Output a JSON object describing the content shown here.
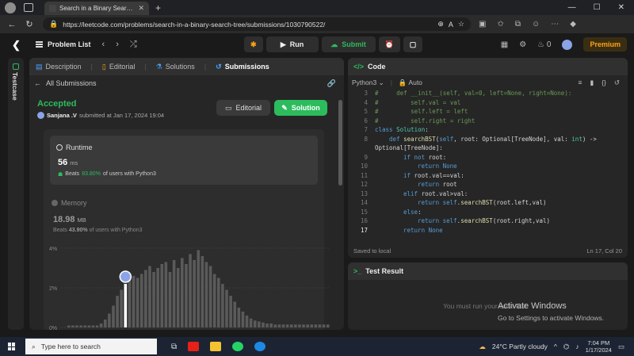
{
  "browser": {
    "tab_title": "Search in a Binary Search Tree - L",
    "url": "https://leetcode.com/problems/search-in-a-binary-search-tree/submissions/1030790522/"
  },
  "header": {
    "problem_list": "Problem List",
    "run": "Run",
    "submit": "Submit",
    "streak_count": "0",
    "premium": "Premium"
  },
  "rail": {
    "label": "Testcase"
  },
  "left_tabs": [
    {
      "label": "Description"
    },
    {
      "label": "Editorial"
    },
    {
      "label": "Solutions"
    },
    {
      "label": "Submissions"
    }
  ],
  "submission": {
    "back_label": "All Submissions",
    "status": "Accepted",
    "user": "Sanjana .V",
    "submitted_text": "submitted at Jan 17, 2024 19:04",
    "editorial_btn": "Editorial",
    "solution_btn": "Solution"
  },
  "runtime": {
    "label": "Runtime",
    "value": "56",
    "unit": "ms",
    "beats_prefix": "Beats",
    "beats_pct": "83.80%",
    "beats_suffix": "of users with Python3"
  },
  "memory": {
    "label": "Memory",
    "value": "18.98",
    "unit": "MB",
    "beats_prefix": "Beats",
    "beats_pct": "43.90%",
    "beats_suffix": "of users with Python3"
  },
  "chart_data": {
    "type": "bar",
    "y_ticks": [
      "4%",
      "2%",
      "0%"
    ],
    "ylim": [
      0,
      4
    ],
    "highlight_index": 14,
    "values": [
      0.1,
      0.1,
      0.1,
      0.1,
      0.1,
      0.1,
      0.1,
      0.1,
      0.2,
      0.4,
      0.7,
      1.1,
      1.6,
      1.9,
      2.2,
      2.4,
      2.6,
      2.5,
      2.7,
      2.9,
      3.1,
      2.8,
      3.0,
      3.2,
      3.3,
      2.8,
      3.4,
      3.0,
      3.5,
      3.2,
      3.7,
      3.4,
      3.9,
      3.6,
      3.3,
      3.1,
      2.7,
      2.5,
      2.2,
      1.9,
      1.6,
      1.3,
      1.0,
      0.8,
      0.6,
      0.45,
      0.35,
      0.3,
      0.25,
      0.2,
      0.2,
      0.15,
      0.15,
      0.15,
      0.15,
      0.15,
      0.15,
      0.15,
      0.15,
      0.15,
      0.15,
      0.15,
      0.15,
      0.15,
      0.15
    ]
  },
  "code": {
    "title": "Code",
    "language": "Python3",
    "mode": "Auto",
    "lines": [
      {
        "n": "3",
        "indent": 0,
        "parts": [
          [
            "cm",
            "#     def __init__(self, val=0, left=None, right=None):"
          ]
        ]
      },
      {
        "n": "4",
        "indent": 0,
        "parts": [
          [
            "cm",
            "#         self.val = val"
          ]
        ]
      },
      {
        "n": "5",
        "indent": 0,
        "parts": [
          [
            "cm",
            "#         self.left = left"
          ]
        ]
      },
      {
        "n": "6",
        "indent": 0,
        "parts": [
          [
            "cm",
            "#         self.right = right"
          ]
        ]
      },
      {
        "n": "7",
        "indent": 0,
        "parts": [
          [
            "kw",
            "class "
          ],
          [
            "ty",
            "Solution"
          ],
          [
            "",
            ":"
          ]
        ]
      },
      {
        "n": "8",
        "indent": 1,
        "parts": [
          [
            "kw",
            "def "
          ],
          [
            "fn",
            "searchBST"
          ],
          [
            "",
            "("
          ],
          [
            "kw",
            "self"
          ],
          [
            "",
            ", root: Optional[TreeNode], val: "
          ],
          [
            "ty",
            "int"
          ],
          [
            "",
            ") ->"
          ]
        ]
      },
      {
        "n": "",
        "indent": 0,
        "parts": [
          [
            "",
            "Optional[TreeNode]:"
          ]
        ]
      },
      {
        "n": "9",
        "indent": 2,
        "parts": [
          [
            "kw",
            "if not "
          ],
          [
            "",
            "root:"
          ]
        ]
      },
      {
        "n": "10",
        "indent": 3,
        "parts": [
          [
            "kw",
            "return "
          ],
          [
            "kw",
            "None"
          ]
        ]
      },
      {
        "n": "11",
        "indent": 2,
        "parts": [
          [
            "kw",
            "if "
          ],
          [
            "",
            "root.val==val:"
          ]
        ]
      },
      {
        "n": "12",
        "indent": 3,
        "parts": [
          [
            "kw",
            "return "
          ],
          [
            "",
            "root"
          ]
        ]
      },
      {
        "n": "13",
        "indent": 2,
        "parts": [
          [
            "kw",
            "elif "
          ],
          [
            "",
            "root.val>val:"
          ]
        ]
      },
      {
        "n": "14",
        "indent": 3,
        "parts": [
          [
            "kw",
            "return "
          ],
          [
            "kw",
            "self"
          ],
          [
            "",
            "."
          ],
          [
            "fn",
            "searchBST"
          ],
          [
            "",
            "(root.left,val)"
          ]
        ]
      },
      {
        "n": "15",
        "indent": 2,
        "parts": [
          [
            "kw",
            "else"
          ],
          [
            "",
            ":"
          ]
        ]
      },
      {
        "n": "16",
        "indent": 3,
        "parts": [
          [
            "kw",
            "return "
          ],
          [
            "kw",
            "self"
          ],
          [
            "",
            "."
          ],
          [
            "fn",
            "searchBST"
          ],
          [
            "",
            "(root.right,val)"
          ]
        ]
      },
      {
        "n": "17",
        "indent": 2,
        "parts": [
          [
            "kw",
            "return "
          ],
          [
            "kw",
            "None"
          ]
        ],
        "current": true
      }
    ],
    "saved": "Saved to local",
    "cursor": "Ln 17, Col 20"
  },
  "test_result": {
    "title": "Test Result",
    "message": "You must run your code first"
  },
  "activate": {
    "title": "Activate Windows",
    "subtitle": "Go to Settings to activate Windows."
  },
  "taskbar": {
    "search_placeholder": "Type here to search",
    "weather": "24°C  Partly cloudy",
    "time": "7:04 PM",
    "date": "1/17/2024"
  },
  "colors": {
    "accent_green": "#2cbb5d",
    "premium": "#ffa116"
  }
}
